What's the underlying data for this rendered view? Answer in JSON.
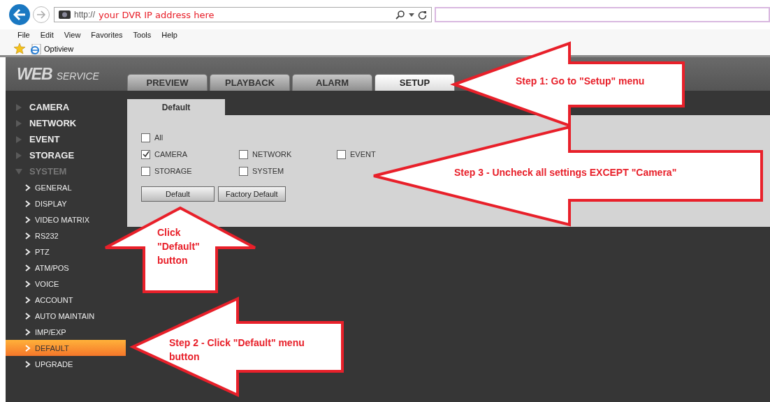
{
  "browser": {
    "address": {
      "prefix": "http://",
      "value": "your DVR IP address here"
    },
    "menu": [
      "File",
      "Edit",
      "View",
      "Favorites",
      "Tools",
      "Help"
    ],
    "favorites": [
      {
        "label": "Optiview"
      }
    ]
  },
  "app": {
    "logo": {
      "main": "WEB",
      "sub": "SERVICE"
    },
    "tabs": [
      {
        "label": "PREVIEW",
        "selected": false
      },
      {
        "label": "PLAYBACK",
        "selected": false
      },
      {
        "label": "ALARM",
        "selected": false
      },
      {
        "label": "SETUP",
        "selected": true
      }
    ],
    "sidebar": [
      {
        "label": "CAMERA",
        "expanded": false
      },
      {
        "label": "NETWORK",
        "expanded": false
      },
      {
        "label": "EVENT",
        "expanded": false
      },
      {
        "label": "STORAGE",
        "expanded": false
      },
      {
        "label": "SYSTEM",
        "expanded": true,
        "children": [
          {
            "label": "GENERAL",
            "selected": false
          },
          {
            "label": "DISPLAY",
            "selected": false
          },
          {
            "label": "VIDEO MATRIX",
            "selected": false
          },
          {
            "label": "RS232",
            "selected": false
          },
          {
            "label": "PTZ",
            "selected": false
          },
          {
            "label": "ATM/POS",
            "selected": false
          },
          {
            "label": "VOICE",
            "selected": false
          },
          {
            "label": "ACCOUNT",
            "selected": false
          },
          {
            "label": "AUTO MAINTAIN",
            "selected": false
          },
          {
            "label": "IMP/EXP",
            "selected": false
          },
          {
            "label": "DEFAULT",
            "selected": true
          },
          {
            "label": "UPGRADE",
            "selected": false
          }
        ]
      }
    ],
    "panel": {
      "tab": "Default",
      "all": {
        "label": "All",
        "checked": false
      },
      "options": [
        {
          "label": "CAMERA",
          "checked": true
        },
        {
          "label": "NETWORK",
          "checked": false
        },
        {
          "label": "EVENT",
          "checked": false
        },
        {
          "label": "STORAGE",
          "checked": false
        },
        {
          "label": "SYSTEM",
          "checked": false
        }
      ],
      "buttons": [
        "Default",
        "Factory Default"
      ]
    }
  },
  "annotations": [
    {
      "kind": "left",
      "lines": [
        "Step 1: Go to \"Setup\" menu"
      ]
    },
    {
      "kind": "left",
      "lines": [
        "Step 3 - Uncheck all settings EXCEPT \"Camera\""
      ]
    },
    {
      "kind": "up",
      "lines": [
        "Click",
        "\"Default\"",
        "button"
      ]
    },
    {
      "kind": "left",
      "lines": [
        "Step 2 - Click \"Default\" menu",
        "button"
      ]
    }
  ]
}
